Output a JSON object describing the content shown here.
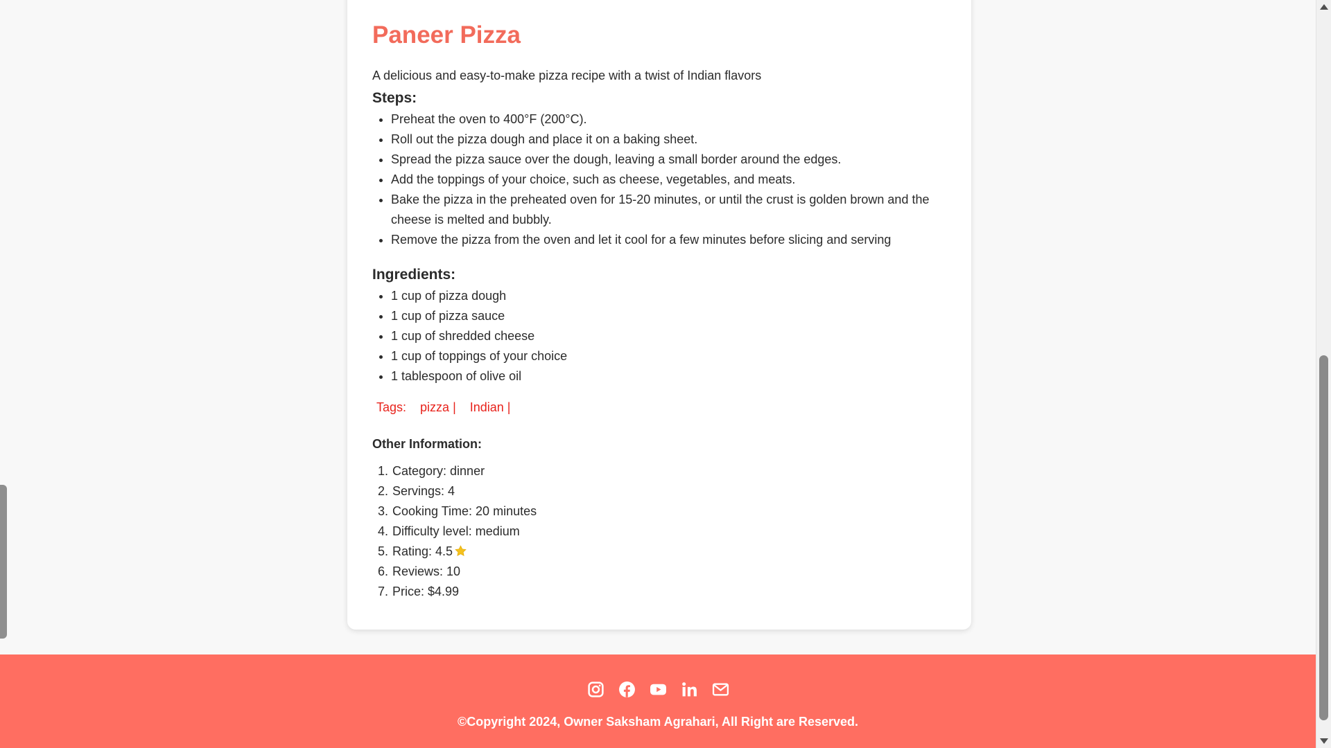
{
  "recipe": {
    "title": "Paneer Pizza",
    "description": "A delicious and easy-to-make pizza recipe with a twist of Indian flavors",
    "steps_heading": "Steps:",
    "steps": [
      "Preheat the oven to 400°F (200°C).",
      "Roll out the pizza dough and place it on a baking sheet.",
      "Spread the pizza sauce over the dough, leaving a small border around the edges.",
      "Add the toppings of your choice, such as cheese, vegetables, and meats.",
      "Bake the pizza in the preheated oven for 15-20 minutes, or until the crust is golden brown and the cheese is melted and bubbly.",
      "Remove the pizza from the oven and let it cool for a few minutes before slicing and serving"
    ],
    "ingredients_heading": "Ingredients:",
    "ingredients": [
      "1 cup of pizza dough",
      "1 cup of pizza sauce",
      "1 cup of shredded cheese",
      "1 cup of toppings of your choice",
      "1 tablespoon of olive oil"
    ],
    "tags_label": "Tags:",
    "tags": [
      "pizza |",
      "Indian |"
    ],
    "other_heading": "Other Information:",
    "other_info": [
      "Category: dinner",
      "Servings: 4",
      "Cooking Time: 20 minutes",
      "Difficulty level: medium",
      "Rating: 4.5",
      "Reviews: 10",
      "Price: $4.99"
    ],
    "rating_icon": "star-icon"
  },
  "footer": {
    "social_icons": [
      "instagram-icon",
      "facebook-icon",
      "youtube-icon",
      "linkedin-icon",
      "mail-icon"
    ],
    "copyright": "©Copyright 2024, Owner Saksham Agrahari, All Right are Reserved."
  },
  "colors": {
    "accent": "#f26b5b",
    "footer_bg": "#ff6e61",
    "tag_red": "#e8231c",
    "star": "#f5c11d"
  }
}
